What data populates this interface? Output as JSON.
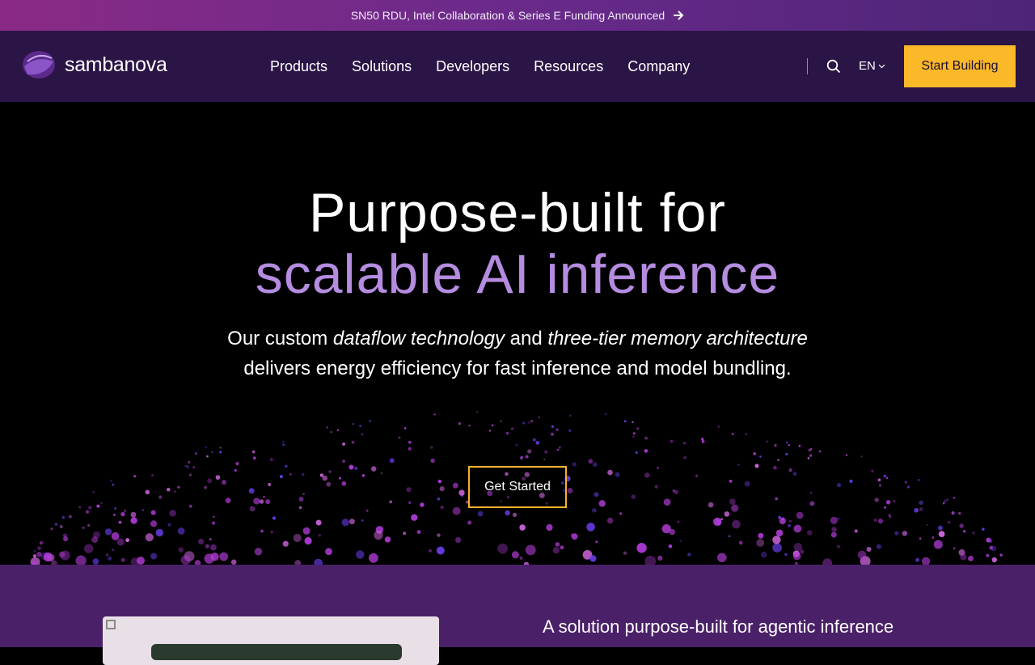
{
  "announcement": {
    "text": "SN50 RDU, Intel Collaboration & Series E Funding Announced",
    "icon": "arrow-right-icon"
  },
  "header": {
    "logo_text": "sambanova",
    "nav": [
      "Products",
      "Solutions",
      "Developers",
      "Resources",
      "Company"
    ],
    "language": "EN",
    "cta_label": "Start Building"
  },
  "hero": {
    "title_line1": "Purpose-built for",
    "title_line2": "scalable AI inference",
    "desc_prefix": "Our custom ",
    "desc_em1": "dataflow technology",
    "desc_mid": " and ",
    "desc_em2": "three-tier memory architecture",
    "desc_line2": "delivers energy efficiency for fast inference and model bundling.",
    "button_label": "Get Started"
  },
  "section2": {
    "title": "A solution purpose-built for agentic inference"
  },
  "colors": {
    "accent": "#fbb829",
    "purple_text": "#b58ce0",
    "header_bg": "#2b1446",
    "section_bg": "#4a2168"
  }
}
